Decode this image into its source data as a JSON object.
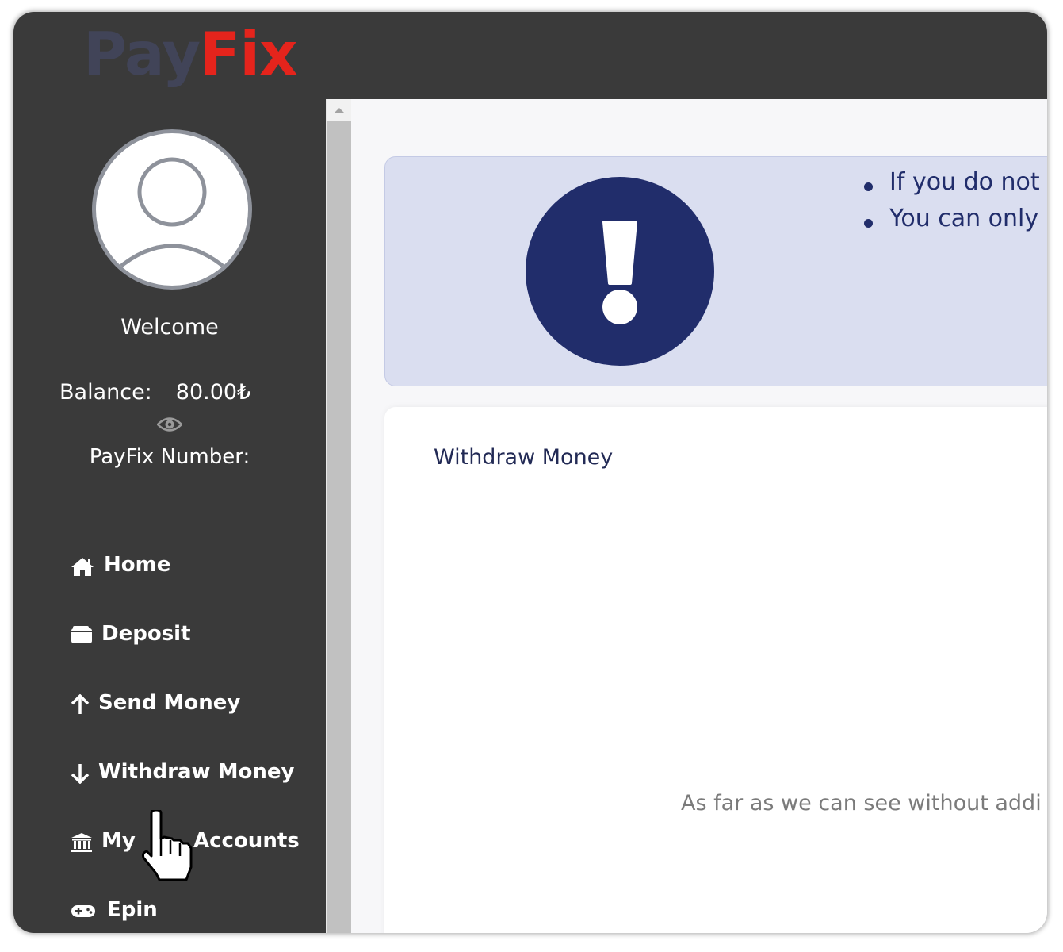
{
  "brand": {
    "logo_pay": "Pay",
    "logo_fix": "Fix",
    "pay_color": "#414458",
    "fix_color": "#e5241c"
  },
  "profile": {
    "welcome": "Welcome",
    "balance_label": "Balance:",
    "balance_value": "80.00₺",
    "payfix_number_label": "PayFix Number:"
  },
  "sidebar": {
    "items": [
      {
        "label": "Home",
        "icon": "home-icon"
      },
      {
        "label": "Deposit",
        "icon": "wallet-icon"
      },
      {
        "label": "Send Money",
        "icon": "arrow-up-icon"
      },
      {
        "label": "Withdraw Money",
        "icon": "arrow-down-icon"
      },
      {
        "label": "My",
        "label_suffix": "Accounts",
        "icon": "bank-icon"
      },
      {
        "label": "Epin",
        "icon": "gamepad-icon"
      }
    ]
  },
  "alert": {
    "icon": "exclamation-icon",
    "items": [
      "If you do not",
      "You can only"
    ]
  },
  "main": {
    "card_title": "Withdraw Money",
    "note": "As far as we can see without addi"
  },
  "colors": {
    "sidebar_bg": "#3a3a3a",
    "alert_bg": "#dadef0",
    "alert_accent": "#212d6b"
  }
}
